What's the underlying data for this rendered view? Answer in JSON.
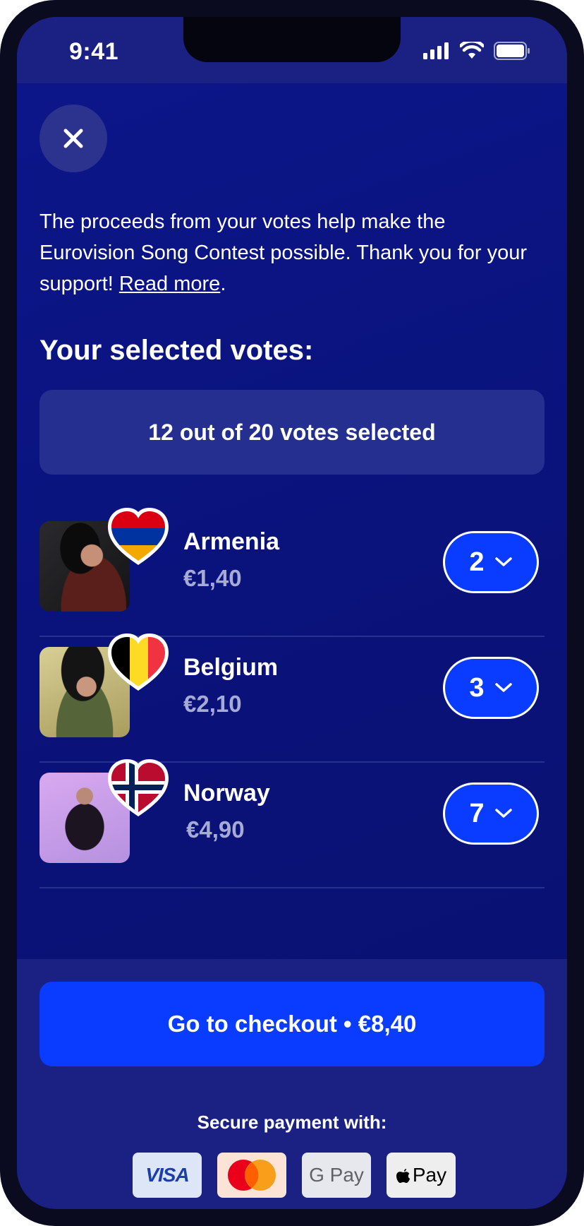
{
  "status": {
    "time": "9:41"
  },
  "intro": {
    "text": "The proceeds from your votes help make the Eurovision Song Contest possible. Thank you for your support! ",
    "link": "Read more",
    "suffix": "."
  },
  "section_title": "Your selected votes:",
  "counter": "12 out of 20 votes selected",
  "votes": [
    {
      "country": "Armenia",
      "price": "€1,40",
      "quantity": "2",
      "flag_colors": [
        "#d90012",
        "#0033a0",
        "#f2a800"
      ]
    },
    {
      "country": "Belgium",
      "price": "€2,10",
      "quantity": "3",
      "flag_colors": [
        "#000000",
        "#fdda24",
        "#ef3340"
      ]
    },
    {
      "country": "Norway",
      "price": "€4,90",
      "quantity": "7",
      "flag_colors": [
        "#ba0c2f",
        "#ffffff",
        "#00205b"
      ]
    }
  ],
  "checkout": {
    "label": "Go to checkout • €8,40"
  },
  "payment": {
    "label": "Secure payment with:",
    "methods": [
      "VISA",
      "Mastercard",
      "G Pay",
      "Pay"
    ]
  },
  "colors": {
    "accent": "#0a3cff",
    "background": "#0a137c",
    "panel": "#1a2182"
  }
}
